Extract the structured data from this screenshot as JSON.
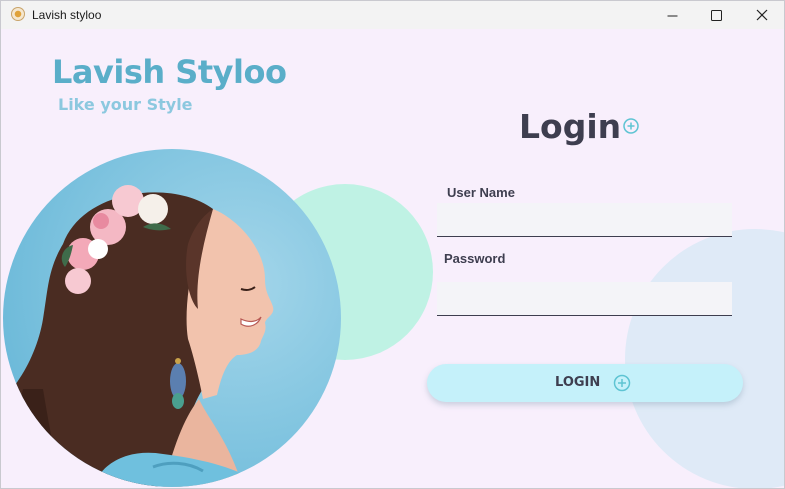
{
  "window": {
    "title": "Lavish styloo",
    "controls": {
      "minimize": "—",
      "maximize": "☐",
      "close": "✕"
    }
  },
  "brand": {
    "name": "Lavish Styloo",
    "tagline": "Like your Style"
  },
  "login_form": {
    "heading": "Login",
    "username": {
      "label": "User Name",
      "value": "",
      "placeholder": ""
    },
    "password": {
      "label": "Password",
      "value": "",
      "placeholder": ""
    },
    "submit_label": "LOGIN"
  },
  "icons": {
    "app": "flower-app-icon",
    "heading_decoration": "plus-circle-icon",
    "button_decoration": "plus-circle-icon"
  },
  "colors": {
    "window_background": "#f8effc",
    "brand_title": "#5aaec9",
    "brand_tagline": "#8cc8df",
    "text_dark": "#3e3e4f",
    "accent_icon": "#5ec4d3",
    "mint_circle": "#bff2e4",
    "photo_circle": "#7ec3df",
    "button_background": "#c5f1fa",
    "field_background": "#f4f4f8"
  }
}
